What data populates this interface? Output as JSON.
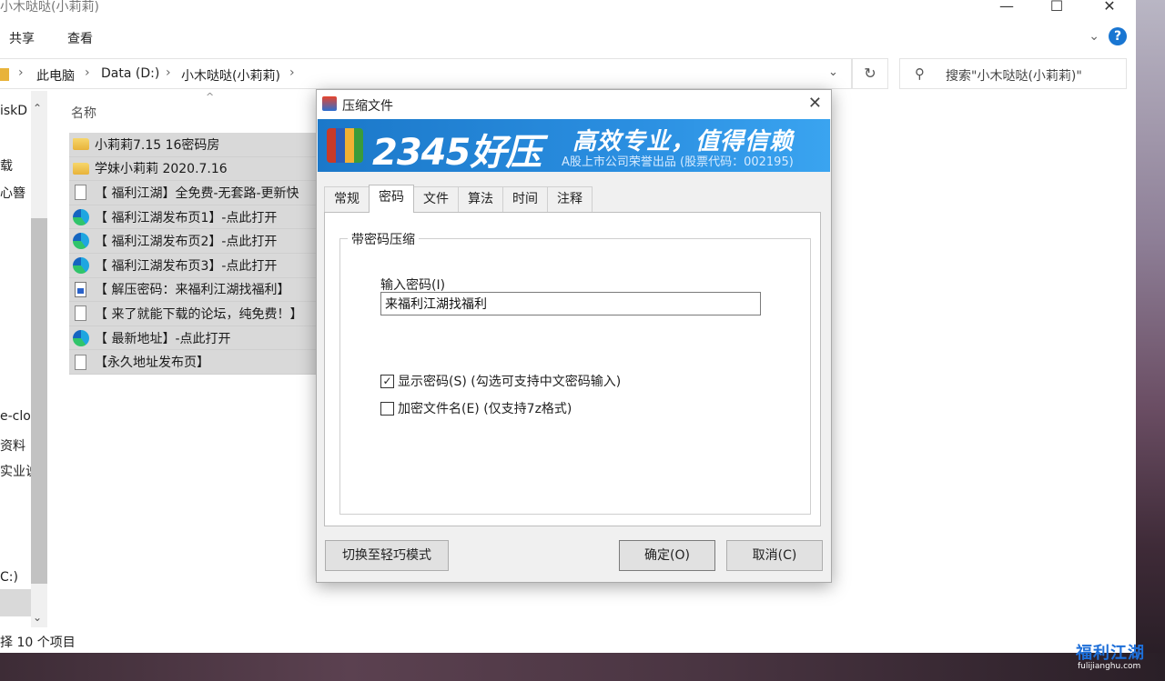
{
  "explorer": {
    "title": "小木哒哒(小莉莉)",
    "window_buttons": {
      "minimize": "—",
      "maximize": "☐",
      "close": "✕"
    },
    "ribbon_tabs": [
      "共享",
      "查看"
    ],
    "address": {
      "items": [
        "此电脑",
        "Data (D:)",
        "小木哒哒(小莉莉)"
      ],
      "separator": "›",
      "dropdown": "⌄",
      "refresh": "↻"
    },
    "search": {
      "icon": "search-icon",
      "text": "搜索\"小木哒哒(小莉莉)\""
    },
    "nav_items": [
      "iskD",
      "载",
      "心簪",
      "e-clo",
      "资料",
      "实业说",
      "C:)"
    ],
    "column_header": "名称",
    "sort_arrow": "^",
    "files": [
      {
        "name": "小莉莉7.15 16密码房",
        "icon": "folder"
      },
      {
        "name": "学妹小莉莉 2020.7.16",
        "icon": "folder"
      },
      {
        "name": "【 福利江湖】全免费-无套路-更新快",
        "icon": "doc"
      },
      {
        "name": "【 福利江湖发布页1】-点此打开",
        "icon": "edge"
      },
      {
        "name": "【 福利江湖发布页2】-点此打开",
        "icon": "edge"
      },
      {
        "name": "【 福利江湖发布页3】-点此打开",
        "icon": "edge"
      },
      {
        "name": "【 解压密码：来福利江湖找福利】",
        "icon": "img"
      },
      {
        "name": "【 来了就能下载的论坛，纯免费！】",
        "icon": "doc"
      },
      {
        "name": "【 最新地址】-点此打开",
        "icon": "edge"
      },
      {
        "name": "【永久地址发布页】",
        "icon": "doc"
      }
    ],
    "status": "择 10 个项目"
  },
  "dialog": {
    "title": "压缩文件",
    "close": "✕",
    "banner": {
      "brand": "2345好压",
      "slogan": "高效专业，值得信赖",
      "subtitle": "A股上市公司荣誉出品 (股票代码：002195)"
    },
    "tabs": [
      "常规",
      "密码",
      "文件",
      "算法",
      "时间",
      "注释"
    ],
    "active_tab": "密码",
    "group_label": "带密码压缩",
    "password_label": "输入密码(I)",
    "password_value": "来福利江湖找福利",
    "show_password": {
      "label": "显示密码(S)  (勾选可支持中文密码输入)",
      "checked": true
    },
    "encrypt_names": {
      "label": "加密文件名(E)  (仅支持7z格式)",
      "checked": false
    },
    "buttons": {
      "switch_mode": "切换至轻巧模式",
      "ok": "确定(O)",
      "cancel": "取消(C)"
    }
  },
  "watermark": {
    "text": "福利江湖",
    "url": "fulijianghu.com"
  }
}
